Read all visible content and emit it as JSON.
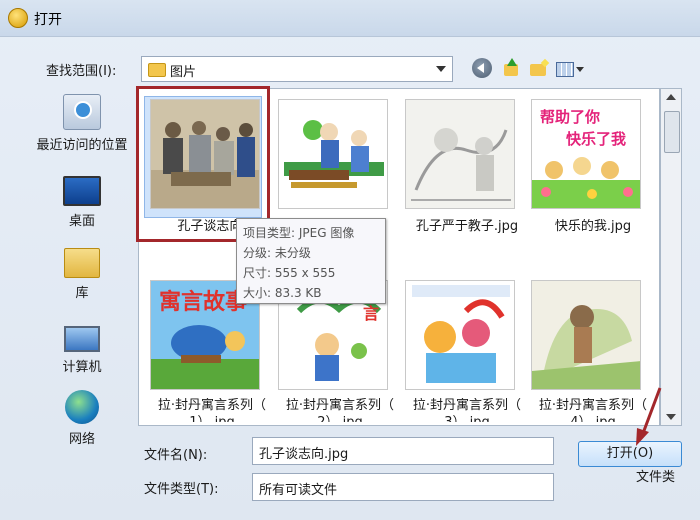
{
  "window": {
    "title": "打开"
  },
  "look_in": {
    "label": "查找范围(I):",
    "value": "图片"
  },
  "toolbar": {
    "icons": [
      "back-icon",
      "up-folder-icon",
      "new-folder-icon",
      "views-menu-icon"
    ]
  },
  "places": [
    {
      "label": "最近访问的位置",
      "icon": "recent-places-icon"
    },
    {
      "label": "桌面",
      "icon": "desktop-icon"
    },
    {
      "label": "库",
      "icon": "library-icon"
    },
    {
      "label": "计算机",
      "icon": "computer-icon"
    },
    {
      "label": "网络",
      "icon": "network-icon"
    }
  ],
  "files": [
    {
      "name": "孔子谈志向.",
      "selected": true
    },
    {
      "name": ""
    },
    {
      "name": "孔子严于教子.jpg"
    },
    {
      "name": "快乐的我.jpg",
      "thumb_text_top": "帮助了你",
      "thumb_text_bottom": "快乐了我"
    },
    {
      "name": "拉·封丹寓言系列（",
      "name_line2": "1）.jpg",
      "thumb_text": "寓言故事"
    },
    {
      "name": "拉·封丹寓言系列（",
      "name_line2": "2）.jpg"
    },
    {
      "name": "拉·封丹寓言系列（",
      "name_line2": "3）.jpg"
    },
    {
      "name": "拉·封丹寓言系列（",
      "name_line2": "4）.jpg"
    }
  ],
  "tooltip": {
    "type": "项目类型: JPEG 图像",
    "rating": "分级: 未分级",
    "dimensions": "尺寸: 555 x 555",
    "size": "大小: 83.3 KB"
  },
  "filename": {
    "label": "文件名(N):",
    "value": "孔子谈志向.jpg"
  },
  "filetype": {
    "label": "文件类型(T):",
    "value": "所有可读文件"
  },
  "buttons": {
    "open": "打开(O)",
    "cancel_fragment": "文件类"
  },
  "colors": {
    "highlight_box": "#a3272b",
    "arrow": "#a3272b",
    "selection": "#cfe3fb"
  }
}
